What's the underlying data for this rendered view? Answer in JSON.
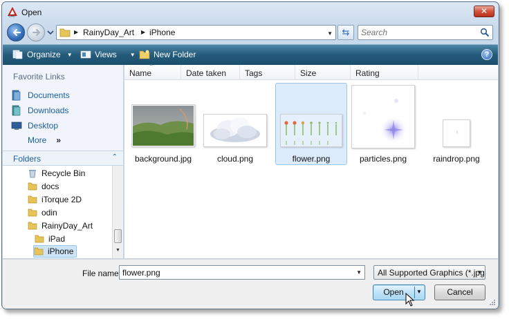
{
  "window": {
    "title": "Open",
    "app_icon": "autocad-icon",
    "close_icon": "close-icon"
  },
  "nav": {
    "back_icon": "back-arrow-icon",
    "forward_icon": "forward-arrow-icon",
    "history_icon": "chevron-down-icon"
  },
  "address": {
    "segments": [
      "RainyDay_Art",
      "iPhone"
    ],
    "refresh_icon": "refresh-icon"
  },
  "search": {
    "placeholder": "Search",
    "icon": "search-icon"
  },
  "toolbar": {
    "organize_label": "Organize",
    "views_label": "Views",
    "new_folder_label": "New Folder",
    "help_icon": "help-icon"
  },
  "favorites": {
    "header": "Favorite Links",
    "items": [
      {
        "label": "Documents",
        "icon": "documents-icon"
      },
      {
        "label": "Downloads",
        "icon": "downloads-icon"
      },
      {
        "label": "Desktop",
        "icon": "desktop-icon"
      }
    ],
    "more_label": "More",
    "more_chevron": "»"
  },
  "folders": {
    "header": "Folders",
    "items": [
      {
        "label": "Recycle Bin",
        "icon": "recycle-bin-icon"
      },
      {
        "label": "docs",
        "icon": "folder-icon"
      },
      {
        "label": "iTorque 2D",
        "icon": "folder-icon"
      },
      {
        "label": "odin",
        "icon": "folder-icon"
      },
      {
        "label": "RainyDay_Art",
        "icon": "folder-icon"
      },
      {
        "label": "iPad",
        "icon": "folder-icon"
      },
      {
        "label": "iPhone",
        "icon": "folder-icon",
        "selected": true
      }
    ]
  },
  "columns": [
    "Name",
    "Date taken",
    "Tags",
    "Size",
    "Rating"
  ],
  "files": [
    {
      "name": "background.jpg",
      "selected": false
    },
    {
      "name": "cloud.png",
      "selected": false
    },
    {
      "name": "flower.png",
      "selected": true
    },
    {
      "name": "particles.png",
      "selected": false
    },
    {
      "name": "raindrop.png",
      "selected": false
    }
  ],
  "bottom": {
    "file_name_label": "File name:",
    "file_name_value": "flower.png",
    "filter_value": "All Supported Graphics (*.jpg;",
    "open_label": "Open",
    "cancel_label": "Cancel"
  },
  "colors": {
    "toolbar": "#245a7a",
    "selection": "#dcebfb",
    "link": "#1b5e9b"
  }
}
